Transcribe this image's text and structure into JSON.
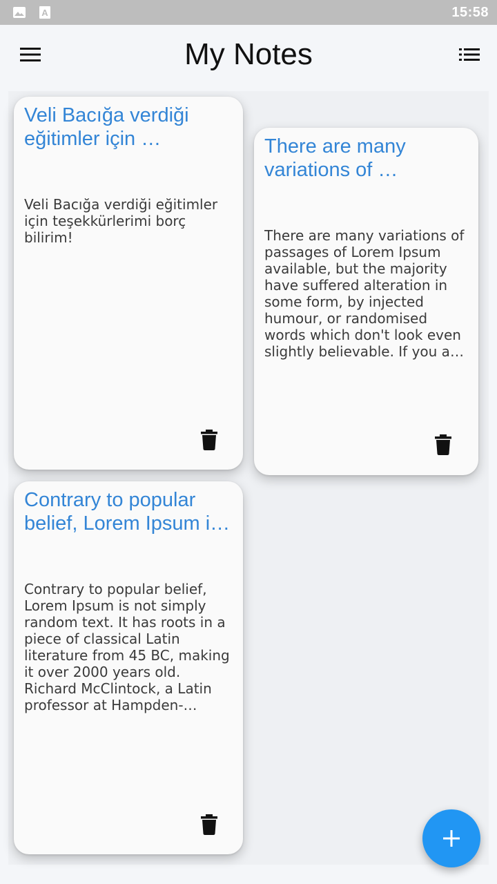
{
  "status_bar": {
    "time": "15:58",
    "icons": [
      "image-icon",
      "font-icon"
    ]
  },
  "app_bar": {
    "title": "My Notes",
    "menu_icon": "menu-icon",
    "view_icon": "list-view-icon"
  },
  "notes": [
    {
      "title": "Veli Bacığa verdiği eğitimler için …",
      "body": "Veli Bacığa verdiği eğitimler için teşekkürlerimi borç bilirim!",
      "delete_icon": "trash-icon"
    },
    {
      "title": "There are many variations of …",
      "body": "There are many variations of passages of Lorem Ipsum available, but the majority have suffered alteration in some form, by injected humour, or randomised words which don't look even slightly believable. If you are going to use a passage of Lorem Ipsum, you need to …",
      "delete_icon": "trash-icon"
    },
    {
      "title": "Contrary to popular belief, Lorem Ipsum i…",
      "body": "Contrary to popular belief, Lorem Ipsum is not simply random text. It has roots in a piece of classical Latin literature from 45 BC, making it over 2000 years old. Richard McClintock, a Latin professor at Hampden-Sydney College in Virginia, looked up one of the …",
      "delete_icon": "trash-icon"
    }
  ],
  "fab": {
    "icon": "plus-icon"
  },
  "colors": {
    "accent": "#2196f3",
    "note_title": "#3385d6",
    "status_bar": "#bdbdbd"
  }
}
